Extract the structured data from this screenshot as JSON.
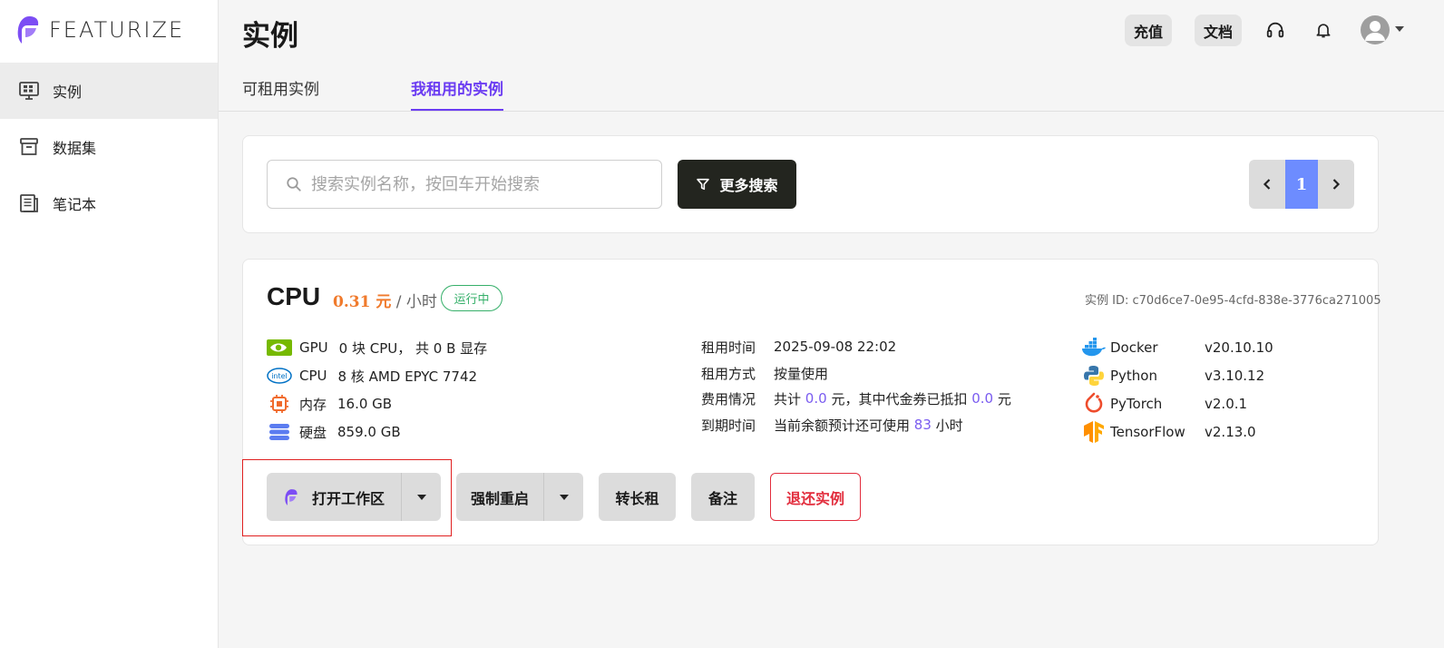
{
  "brand": {
    "name": "FEATURIZE",
    "accent": "#6b3cf2"
  },
  "sidebar": {
    "items": [
      {
        "label": "实例",
        "icon": "monitor-icon",
        "active": true
      },
      {
        "label": "数据集",
        "icon": "archive-icon",
        "active": false
      },
      {
        "label": "笔记本",
        "icon": "notebook-icon",
        "active": false
      }
    ]
  },
  "header": {
    "title": "实例",
    "recharge_label": "充值",
    "docs_label": "文档",
    "icons": [
      "headset-icon",
      "bell-icon",
      "avatar-icon"
    ]
  },
  "tabs": [
    {
      "label": "可租用实例",
      "active": false
    },
    {
      "label": "我租用的实例",
      "active": true
    }
  ],
  "search": {
    "placeholder": "搜索实例名称，按回车开始搜索",
    "value": "",
    "more_label": "更多搜索"
  },
  "pagination": {
    "current": "1"
  },
  "instance": {
    "name": "CPU",
    "price": "0.31 元",
    "price_unit": "/ 小时",
    "status": "运行中",
    "id_label": "实例 ID:",
    "id": "c70d6ce7-0e95-4cfd-838e-3776ca271005",
    "specs": [
      {
        "key": "GPU",
        "value": "0 块 CPU， 共 0 B 显存",
        "icon": "nvidia-icon"
      },
      {
        "key": "CPU",
        "value": "8 核 AMD EPYC 7742",
        "icon": "intel-icon"
      },
      {
        "key": "内存",
        "value": "16.0 GB",
        "icon": "memory-chip-icon"
      },
      {
        "key": "硬盘",
        "value": "859.0 GB",
        "icon": "disk-icon"
      }
    ],
    "rent": {
      "time_label": "租用时间",
      "time": "2025-09-08 22:02",
      "mode_label": "租用方式",
      "mode": "按量使用",
      "cost_label": "费用情况",
      "cost_prefix": "共计",
      "cost_total": "0.0",
      "cost_mid": "元，其中代金券已抵扣",
      "cost_voucher": "0.0",
      "cost_suffix": "元",
      "expire_label": "到期时间",
      "expire_prefix": "当前余额预计还可使用",
      "expire_hours": "83",
      "expire_suffix": "小时"
    },
    "frameworks": [
      {
        "name": "Docker",
        "version": "v20.10.10",
        "icon": "docker-icon"
      },
      {
        "name": "Python",
        "version": "v3.10.12",
        "icon": "python-icon"
      },
      {
        "name": "PyTorch",
        "version": "v2.0.1",
        "icon": "pytorch-icon"
      },
      {
        "name": "TensorFlow",
        "version": "v2.13.0",
        "icon": "tensorflow-icon"
      }
    ]
  },
  "actions": {
    "open_workspace": "打开工作区",
    "force_restart": "强制重启",
    "long_rent": "转长租",
    "note": "备注",
    "return_instance": "退还实例"
  }
}
